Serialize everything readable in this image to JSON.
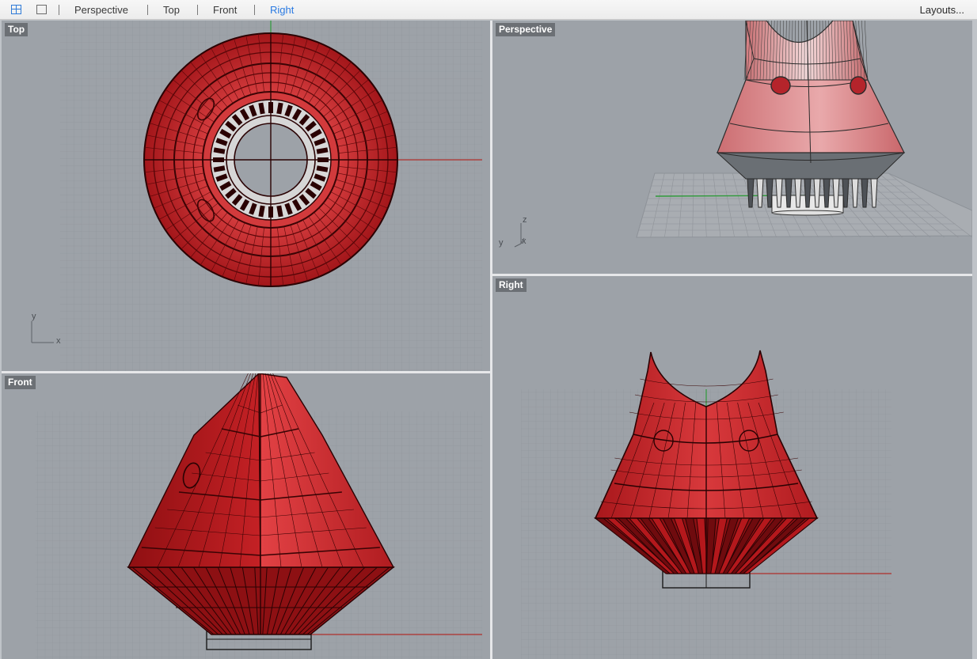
{
  "toolbar": {
    "tabs": [
      {
        "label": "Perspective",
        "active": false
      },
      {
        "label": "Top",
        "active": false
      },
      {
        "label": "Front",
        "active": false
      },
      {
        "label": "Right",
        "active": true
      }
    ],
    "layouts_label": "Layouts...",
    "icons": [
      "four-viewports-icon",
      "single-viewport-icon"
    ]
  },
  "viewports": {
    "top": {
      "label": "Top",
      "axis_x": "x",
      "axis_y": "y"
    },
    "perspective": {
      "label": "Perspective",
      "axis_x": "x",
      "axis_y": "y",
      "axis_z": "z"
    },
    "front": {
      "label": "Front"
    },
    "right": {
      "label": "Right"
    }
  },
  "colors": {
    "viewport_bg": "#9da2a8",
    "grid_line": "#8d9298",
    "grid_major": "#7c8187",
    "model_red": "#b91a1e",
    "model_dark": "#4a0506",
    "x_axis": "#b0302c",
    "y_axis": "#2f9a3a",
    "active_tab": "#2a7ae2"
  }
}
